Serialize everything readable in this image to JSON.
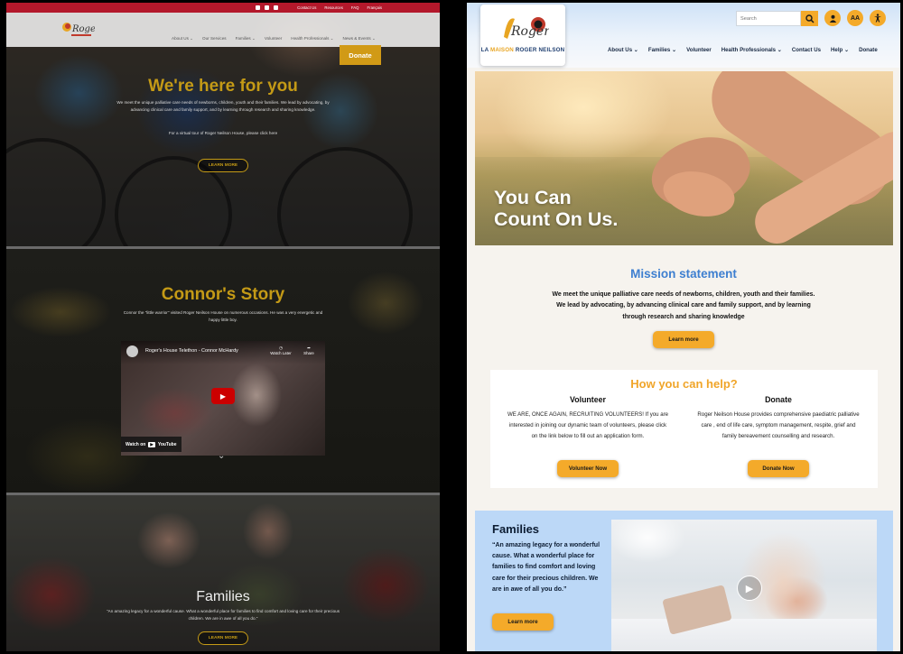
{
  "old_site": {
    "topbar": {
      "links": [
        "Contact Us",
        "Resources",
        "FAQ",
        "Français"
      ],
      "social_icons": [
        "facebook-icon",
        "twitter-icon",
        "email-icon"
      ],
      "color": "#b3182b"
    },
    "nav": [
      "About Us ⌄",
      "Our Services",
      "Families ⌄",
      "Volunteer",
      "Health Professionals ⌄",
      "News & Events ⌄"
    ],
    "donate_label": "Donate",
    "hero": {
      "title": "We're here for you",
      "text": "We meet the unique palliative care needs of newborns, children, youth and their families. We lead by advocating, by advancing clinical care and family support, and by learning through research and sharing knowledge.",
      "tour_text": "For a virtual tour of Roger Neilson House, please click here",
      "button": "LEARN MORE"
    },
    "story": {
      "title": "Connor's Story",
      "text": "Connor the \"little warrior\" visited Roger Neilson House on numerous occasions. He was a very energetic and happy little boy.",
      "video_title": "Roger's House Telethon - Connor McHardy",
      "watch_later": "Watch Later",
      "share": "Share",
      "watch_on": "Watch on",
      "youtube": "YouTube"
    },
    "families": {
      "title": "Families",
      "text": "\"An amazing legacy for a wonderful cause. What a wonderful place for families to find comfort and loving care for their precious children. We are in awe of all you do.\"",
      "button": "LEARN MORE"
    },
    "accent": "#c49a16"
  },
  "new_site": {
    "logo": {
      "name_part1": "LA ",
      "name_highlight": "MAISON",
      "name_part2": " ROGER NEILSON"
    },
    "search_placeholder": "Search",
    "icons": [
      "search-icon",
      "user-icon",
      "text-size-icon",
      "accessibility-icon"
    ],
    "text_size_label": "AA",
    "nav": [
      "About Us",
      "Families",
      "Volunteer",
      "Health Professionals",
      "Contact Us",
      "Help",
      "Donate"
    ],
    "hero_title_line1": "You Can",
    "hero_title_line2": "Count On Us.",
    "mission": {
      "title": "Mission statement",
      "text": "We meet the unique palliative care needs of newborns, children, youth and their families. We lead by advocating, by advancing clinical care and family support, and by learning through research and sharing knowledge",
      "button": "Learn more"
    },
    "help": {
      "title": "How you can help?",
      "volunteer": {
        "heading": "Volunteer",
        "text": "WE ARE, ONCE AGAIN, RECRUITING VOLUNTEERS! If you are interested in joining our dynamic team of volunteers, please click on the link below to fill out an application form.",
        "button": "Volunteer Now"
      },
      "donate": {
        "heading": "Donate",
        "text": "Roger Neilson House provides comprehensive paediatric palliative care , end of life care, symptom management, respite, grief and family bereavement counselling and research.",
        "button": "Donate Now"
      }
    },
    "families": {
      "title": "Families",
      "quote": "“An amazing legacy for a wonderful cause. What a wonderful place for families to find comfort and loving care for their precious children. We are in awe of all you do.”",
      "button": "Learn more"
    },
    "colors": {
      "accent": "#f4aa2a",
      "heading_blue": "#3e7fd0",
      "help_orange": "#f0a529",
      "families_bg": "#bcd8f7"
    }
  }
}
